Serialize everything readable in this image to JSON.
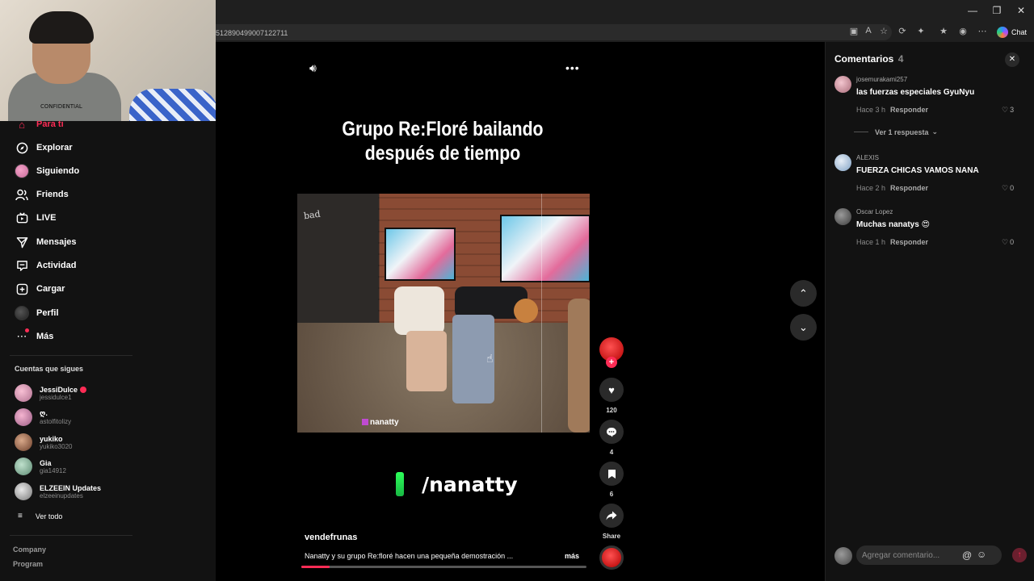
{
  "browser": {
    "url": "512890499007122711",
    "chat_label": "Chat",
    "win_minimize": "—",
    "win_restore": "❐",
    "win_close": "✕"
  },
  "webcam": {
    "shirt_text": "CONFIDENTIAL"
  },
  "sidebar": {
    "items": [
      {
        "label": "Para ti",
        "icon": "home-icon"
      },
      {
        "label": "Explorar",
        "icon": "compass-icon"
      },
      {
        "label": "Siguiendo",
        "icon": "following-avatar-icon"
      },
      {
        "label": "Friends",
        "icon": "friends-icon"
      },
      {
        "label": "LIVE",
        "icon": "live-tv-icon"
      },
      {
        "label": "Mensajes",
        "icon": "send-icon"
      },
      {
        "label": "Actividad",
        "icon": "inbox-icon"
      },
      {
        "label": "Cargar",
        "icon": "plus-square-icon"
      },
      {
        "label": "Perfil",
        "icon": "profile-avatar-icon"
      },
      {
        "label": "Más",
        "icon": "more-dots-icon"
      }
    ],
    "following_title": "Cuentas que sigues",
    "following": [
      {
        "name": "JessiDulce",
        "handle": "jessidulce1"
      },
      {
        "name": "ღ.",
        "handle": "astolfitolizy"
      },
      {
        "name": "yukiko",
        "handle": "yukiko3020"
      },
      {
        "name": "Gia",
        "handle": "gia14912"
      },
      {
        "name": "ELZEEIN Updates",
        "handle": "elzeeinupdates"
      }
    ],
    "see_all": "Ver todo",
    "footer": [
      "Company",
      "Program"
    ]
  },
  "video": {
    "title_line1": "Grupo Re:Floré bailando",
    "title_line2": "después de tiempo",
    "chalk_text": "bad",
    "watermark": "nanatty",
    "caption_handle": "/nanatty",
    "author": "vendefrunas",
    "description": "Nanatty y su grupo Re:floré hacen una pequeña demostración ...",
    "more": "más",
    "progress": 0.1
  },
  "actions": {
    "likes": "120",
    "comments": "4",
    "saves": "6",
    "share": "Share",
    "follow_plus": "+"
  },
  "comments_panel": {
    "title": "Comentarios",
    "count": "4",
    "comments": [
      {
        "user": "josemurakami257",
        "text": "las fuerzas especiales GyuNyu",
        "time": "Hace 3 h",
        "reply": "Responder",
        "likes": "3"
      },
      {
        "user": "ALEXIS",
        "text": "FUERZA CHICAS VAMOS NANA",
        "time": "Hace 2 h",
        "reply": "Responder",
        "likes": "0"
      },
      {
        "user": "Oscar Lopez",
        "text": "Muchas nanatys 😍",
        "time": "Hace 1 h",
        "reply": "Responder",
        "likes": "0"
      }
    ],
    "view_replies": "Ver 1 respuesta",
    "input_placeholder": "Agregar comentario..."
  },
  "colors": {
    "accent": "#fe2c55",
    "panel_bg": "#121212",
    "green_mark": "#2dff5a"
  }
}
